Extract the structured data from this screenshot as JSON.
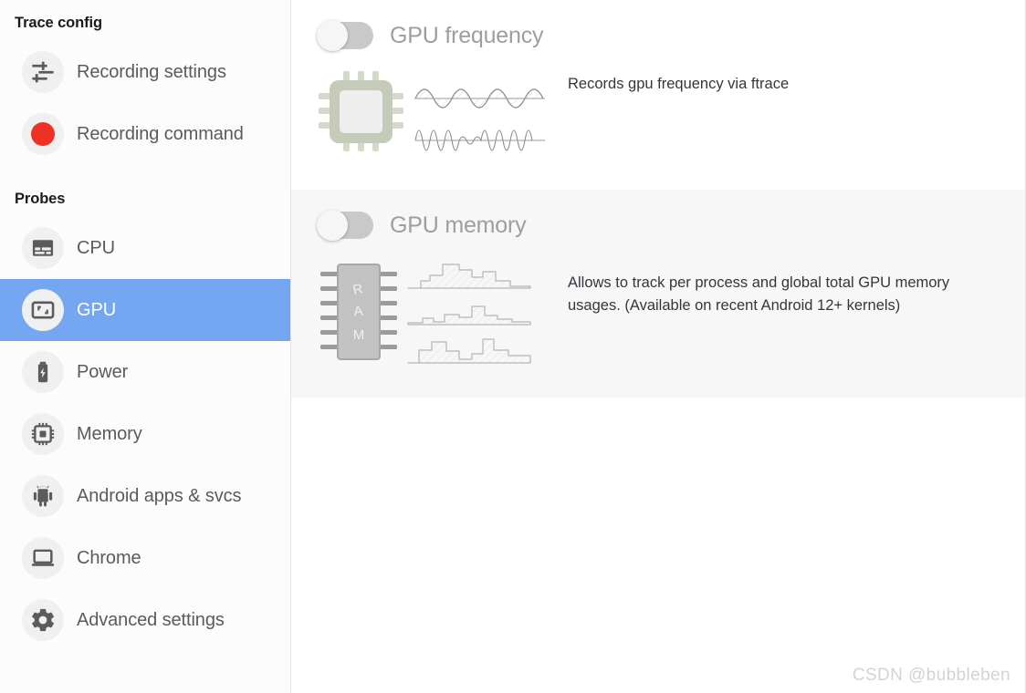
{
  "sidebar": {
    "sections": [
      {
        "title": "Trace config"
      },
      {
        "title": "Probes"
      }
    ],
    "config_items": [
      {
        "label": "Recording settings",
        "icon": "tune-sliders-icon",
        "selected": false
      },
      {
        "label": "Recording command",
        "icon": "record-dot-icon",
        "selected": false
      }
    ],
    "probe_items": [
      {
        "label": "CPU",
        "icon": "cpu-icon",
        "selected": false
      },
      {
        "label": "GPU",
        "icon": "gpu-screen-icon",
        "selected": true
      },
      {
        "label": "Power",
        "icon": "battery-icon",
        "selected": false
      },
      {
        "label": "Memory",
        "icon": "memory-chip-icon",
        "selected": false
      },
      {
        "label": "Android apps & svcs",
        "icon": "android-robot-icon",
        "selected": false
      },
      {
        "label": "Chrome",
        "icon": "laptop-icon",
        "selected": false
      },
      {
        "label": "Advanced settings",
        "icon": "gear-icon",
        "selected": false
      }
    ]
  },
  "main": {
    "probes": [
      {
        "title": "GPU frequency",
        "description": "Records gpu frequency via ftrace",
        "toggle_state": "off",
        "art": "cpu-chip-with-waveforms"
      },
      {
        "title": "GPU memory",
        "description": "Allows to track per process and global total GPU memory usages. (Available on recent Android 12+ kernels)",
        "toggle_state": "off",
        "art": "ram-chip-with-step-charts"
      }
    ]
  },
  "watermark": {
    "text": "CSDN @bubbleben"
  },
  "colors": {
    "accent_selected": "#74a6f2",
    "record_red": "#ee3124",
    "panel_shaded": "#f7f7f7",
    "heading_gray": "#9e9e9e",
    "toggle_track": "#c9c9c9"
  }
}
